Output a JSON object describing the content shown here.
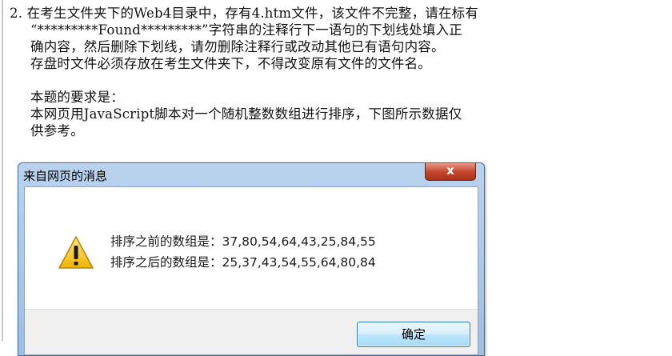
{
  "question": {
    "lines": [
      "2. 在考生文件夹下的Web4目录中，存有4.htm文件，该文件不完整，请在标有",
      "“*********Found*********”字符串的注释行下一语句的下划线处填入正",
      "确内容，然后删除下划线，请勿删除注释行或改动其他已有语句内容。",
      "存盘时文件必须存放在考生文件夹下，不得改变原有文件的文件名。",
      "本题的要求是：",
      "本网页用JavaScript脚本对一个随机整数数组进行排序，下图所示数据仅",
      "供参考。"
    ]
  },
  "dialog": {
    "title": "来自网页的消息",
    "close_symbol": "x",
    "before_line": "排序之前的数组是：37,80,54,64,43,25,84,55",
    "after_line": "排序之后的数组是：25,37,43,54,55,64,80,84",
    "ok_label": "确定",
    "icon": "warning-icon"
  }
}
